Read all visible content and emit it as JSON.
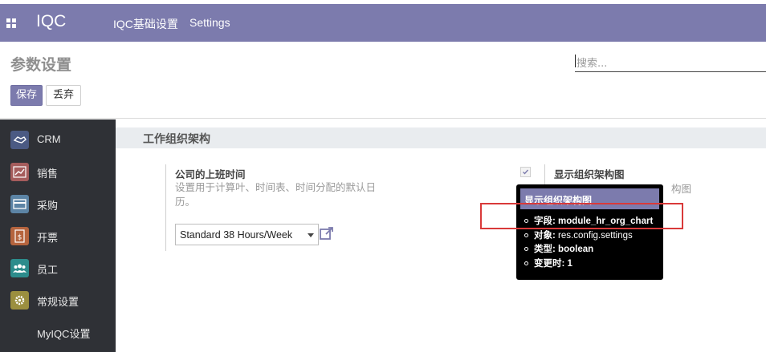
{
  "topbar": {
    "brand": "IQC",
    "menu": [
      "IQC基础设置",
      "Settings"
    ]
  },
  "control_panel": {
    "title": "参数设置",
    "search_placeholder": "搜索...",
    "save_label": "保存",
    "discard_label": "丢弃"
  },
  "sidebar": {
    "items": [
      {
        "label": "CRM",
        "icon": "handshake-icon",
        "color": "#4b5a83"
      },
      {
        "label": "销售",
        "icon": "chart-trend-icon",
        "color": "#a55c5c"
      },
      {
        "label": "采购",
        "icon": "credit-card-icon",
        "color": "#5c84a5"
      },
      {
        "label": "开票",
        "icon": "invoice-dollar-icon",
        "color": "#b5643e"
      },
      {
        "label": "员工",
        "icon": "people-icon",
        "color": "#2c8c8c"
      },
      {
        "label": "常规设置",
        "icon": "gear-icon",
        "color": "#9b8f3f"
      },
      {
        "label": "MyIQC设置",
        "icon": "",
        "color": ""
      }
    ]
  },
  "section": {
    "title": "工作组织架构"
  },
  "working_hours": {
    "heading": "公司的上班时间",
    "description": "设置用于计算叶、时间表、时间分配的默认日历。",
    "selected": "Standard 38 Hours/Week"
  },
  "org_chart": {
    "heading": "显示组织架构图",
    "description_visible": "构图",
    "checked": true
  },
  "tooltip": {
    "title": "显示组织架构图",
    "rows": [
      {
        "key": "字段:",
        "value": "module_hr_org_chart"
      },
      {
        "key": "对象:",
        "value": "res.config.settings"
      },
      {
        "key": "类型:",
        "value": "boolean"
      },
      {
        "key": "变更时:",
        "value": "1"
      }
    ]
  },
  "colors": {
    "brand": "#7c7bad",
    "sidebar_bg": "#2f3136",
    "highlight": "#d93a3a"
  }
}
